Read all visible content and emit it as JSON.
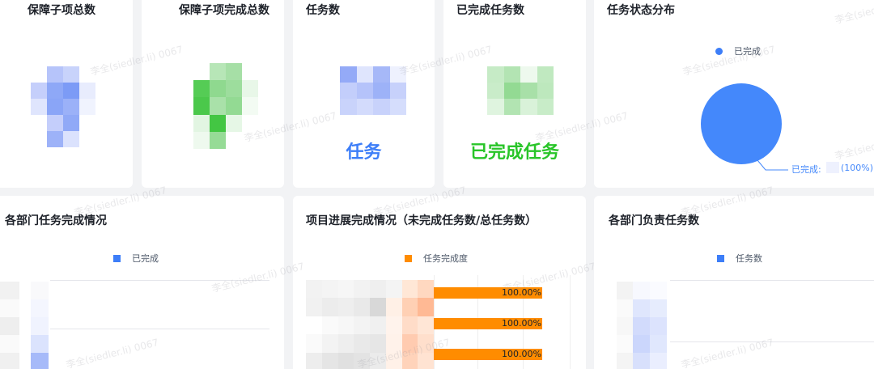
{
  "colors": {
    "blue": "#3d7ef8",
    "green": "#29c529",
    "orange": "#ff8c00",
    "card": "#ffffff",
    "page": "#f2f3f5"
  },
  "cards": {
    "guarantee_total": {
      "title": "保障子项总数"
    },
    "guarantee_done": {
      "title": "保障子项完成总数"
    },
    "tasks": {
      "title": "任务数",
      "value_label": "任务"
    },
    "tasks_done": {
      "title": "已完成任务数",
      "value_label": "已完成任务"
    },
    "status_dist": {
      "title": "任务状态分布",
      "legend": "已完成",
      "slice_label": "已完成:",
      "slice_percent": "(100%)"
    },
    "dept_completion": {
      "title": "各部门任务完成情况",
      "legend": "已完成"
    },
    "project_progress": {
      "title": "项目进展完成情况（未完成任务数/总任务数）",
      "legend": "任务完成度"
    },
    "dept_tasks": {
      "title": "各部门负责任务数",
      "legend": "任务数"
    }
  },
  "chart_data": [
    {
      "type": "pie",
      "title": "任务状态分布",
      "categories": [
        "已完成"
      ],
      "values": [
        100
      ]
    },
    {
      "type": "bar",
      "title": "项目进展完成情况（未完成任务数/总任务数）",
      "series": [
        {
          "name": "任务完成度",
          "values": [
            100,
            100,
            100
          ]
        }
      ],
      "data_labels": [
        "100.00%",
        "100.00%",
        "100.00%"
      ]
    }
  ],
  "watermark": {
    "text": "李全(siedler.li) 0067"
  }
}
